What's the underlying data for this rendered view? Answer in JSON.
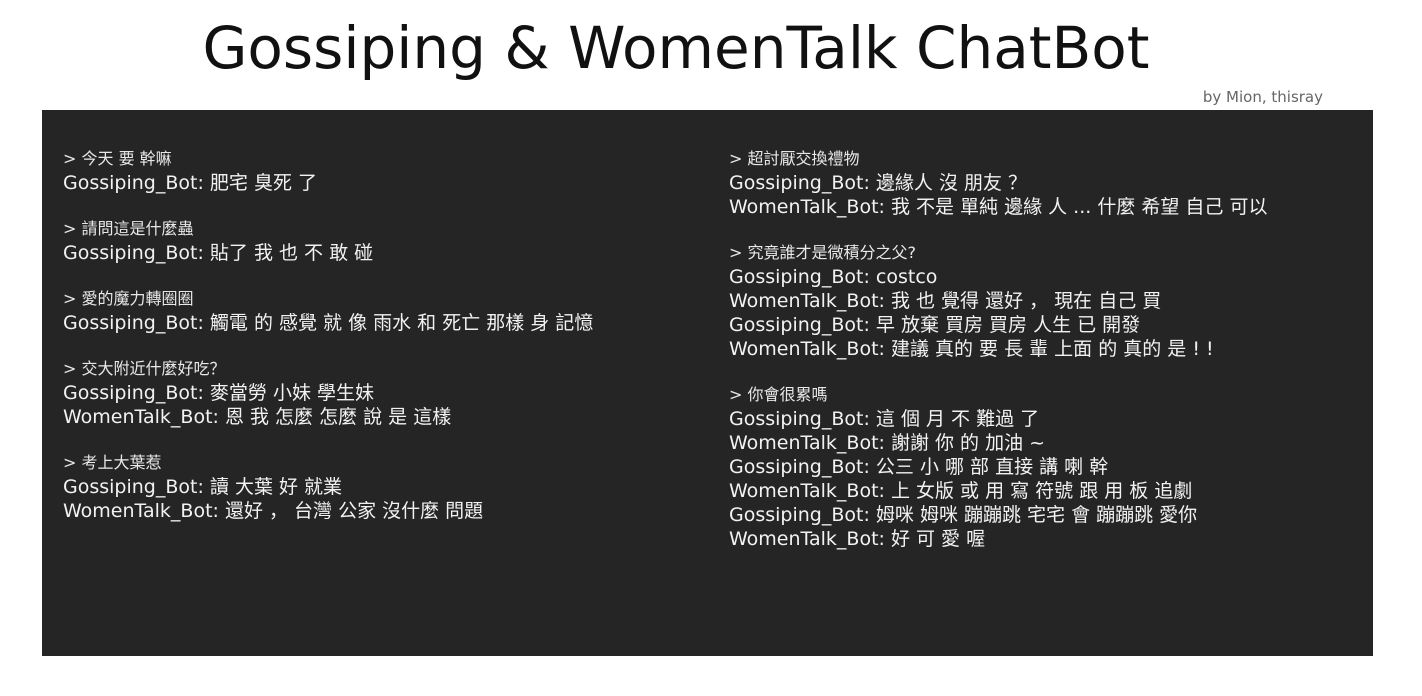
{
  "header": {
    "title": "Gossiping & WomenTalk ChatBot",
    "byline": "by Mion, thisray"
  },
  "left_column": [
    {
      "prompt": "> 今天 要 幹嘛",
      "replies": [
        "Gossiping_Bot: 肥宅 臭死 了"
      ]
    },
    {
      "prompt": "> 請問這是什麼蟲",
      "replies": [
        "Gossiping_Bot: 貼了 我 也 不 敢 碰"
      ]
    },
    {
      "prompt": "> 愛的魔力轉圈圈",
      "replies": [
        "Gossiping_Bot: 觸電 的 感覺 就 像 雨水 和 死亡 那樣 身 記憶"
      ]
    },
    {
      "prompt": "> 交大附近什麼好吃？",
      "replies": [
        "Gossiping_Bot: 麥當勞 小妹 學生妹",
        "WomenTalk_Bot: 恩 我 怎麼 怎麼 說 是 這樣"
      ]
    },
    {
      "prompt": "> 考上大葉惹",
      "replies": [
        "Gossiping_Bot: 讀 大葉 好 就業",
        "WomenTalk_Bot: 還好 ， 台灣 公家 沒什麼 問題"
      ]
    }
  ],
  "right_column": [
    {
      "prompt": "> 超討厭交換禮物",
      "replies": [
        "Gossiping_Bot: 邊緣人 沒 朋友 ？",
        "WomenTalk_Bot: 我 不是 單純 邊緣 人 ... 什麼 希望 自己 可以"
      ]
    },
    {
      "prompt": "> 究竟誰才是微積分之父?",
      "replies": [
        "Gossiping_Bot: costco",
        "WomenTalk_Bot: 我 也 覺得 還好 ， 現在 自己 買",
        "Gossiping_Bot: 早 放棄 買房 買房 人生 已 開發",
        "WomenTalk_Bot: 建議 真的 要 長 輩 上面 的 真的 是 ! !"
      ]
    },
    {
      "prompt": "> 你會很累嗎",
      "replies": [
        "Gossiping_Bot: 這 個 月 不 難過 了",
        "WomenTalk_Bot: 謝謝 你 的 加油 ~",
        "Gossiping_Bot: 公三 小 哪 部 直接 講 喇 幹",
        "WomenTalk_Bot: 上 女版 或 用 寫 符號 跟 用 板 追劇",
        "Gossiping_Bot: 姆咪 姆咪 蹦蹦跳 宅宅 會 蹦蹦跳 愛你",
        "WomenTalk_Bot: 好 可 愛 喔"
      ]
    }
  ],
  "colors": {
    "panel_background": "#252525",
    "panel_text": "#f2f2f2",
    "title_text": "#111111",
    "byline_text": "#666666"
  }
}
